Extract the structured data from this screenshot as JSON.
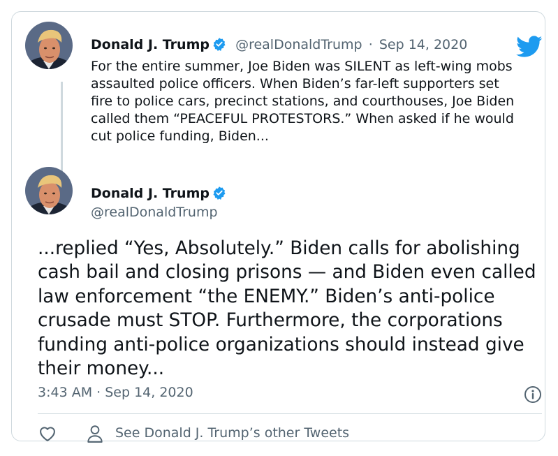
{
  "parent_tweet": {
    "author_name": "Donald J. Trump",
    "handle": "@realDonaldTrump",
    "separator": "·",
    "date": "Sep 14, 2020",
    "text": "For the entire summer, Joe Biden was SILENT as left-wing mobs assaulted police officers. When Biden’s far-left supporters set fire to police cars, precinct stations, and courthouses, Joe Biden called them “PEACEFUL PROTESTORS.” When asked if he would cut police funding, Biden..."
  },
  "main_tweet": {
    "author_name": "Donald J. Trump",
    "handle": "@realDonaldTrump",
    "text": "...replied “Yes, Absolutely.” Biden calls for abolishing cash bail and closing prisons — and Biden even called law enforcement “the ENEMY.” Biden’s anti-police crusade must STOP. Furthermore, the corporations funding anti-police organizations should instead give their money...",
    "timestamp": "3:43 AM · Sep 14, 2020"
  },
  "actions": {
    "see_other_tweets": "See Donald J. Trump’s other Tweets"
  },
  "icons": {
    "verified": "verified-badge-icon",
    "bird": "twitter-bird-icon",
    "info": "info-icon",
    "like": "heart-icon",
    "profile": "person-icon"
  },
  "colors": {
    "brand_blue": "#1d9bf0",
    "text_primary": "#0f1419",
    "text_secondary": "#536471",
    "border": "#cfd9de"
  }
}
